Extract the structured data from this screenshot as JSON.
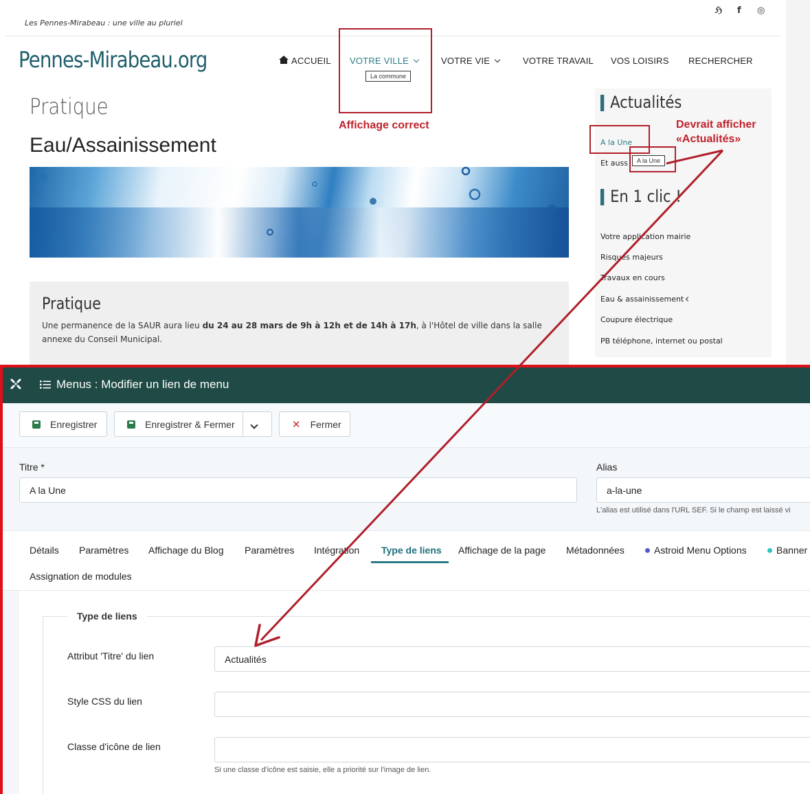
{
  "site": {
    "tagline": "Les Pennes-Mirabeau : une ville au pluriel",
    "social_icons": [
      "accessibility-icon",
      "facebook-icon",
      "instagram-icon"
    ],
    "logo": "Pennes-Mirabeau.org",
    "nav": {
      "accueil": "ACCUEIL",
      "votre_ville": "VOTRE VILLE",
      "votre_vie": "VOTRE VIE",
      "votre_travail": "VOTRE TRAVAIL",
      "vos_loisirs": "VOS LOISIRS",
      "rechercher": "RECHERCHER"
    },
    "nav_tooltip": "La commune",
    "page_title": "Pratique",
    "page_subtitle": "Eau/Assainissement",
    "box": {
      "title": "Pratique",
      "text_before": "Une permanence de la SAUR aura lieu ",
      "text_bold1": "du 24 au 28 mars de 9h à 12h et de 14h à 17h",
      "text_after": ", à l'Hôtel de ville dans la salle annexe du Conseil Municipal."
    },
    "sidebar": {
      "actualites_title": "Actualités",
      "links_actu": [
        "A la Une",
        "Et auss"
      ],
      "tooltip": "A la Une",
      "clic_title": "En 1 clic !",
      "links_clic": [
        "Votre application mairie",
        "Risques majeurs",
        "Travaux en cours",
        "Eau & assainissement",
        "Coupure électrique",
        "PB téléphone, internet ou postal"
      ]
    },
    "annotations": {
      "correct": "Affichage correct",
      "should_line1": "Devrait afficher",
      "should_line2": "«Actualités»"
    }
  },
  "admin": {
    "title": "Menus : Modifier un lien de menu",
    "toolbar": {
      "save": "Enregistrer",
      "save_close": "Enregistrer & Fermer",
      "close": "Fermer"
    },
    "titre_label": "Titre *",
    "titre_value": "A la Une",
    "alias_label": "Alias",
    "alias_value": "a-la-une",
    "alias_help": "L'alias est utilisé dans l'URL SEF. Si le champ est laissé vi",
    "tabs": [
      "Détails",
      "Paramètres",
      "Affichage du Blog",
      "Paramètres",
      "Intégration",
      "Type de liens",
      "Affichage de la page",
      "Métadonnées",
      "Astroid Menu Options",
      "Banner",
      "Assignation de modules"
    ],
    "fieldset_legend": "Type de liens",
    "fields": {
      "title_attr_label": "Attribut 'Titre' du lien",
      "title_attr_value": "Actualités",
      "css_label": "Style CSS du lien",
      "css_value": "",
      "icon_label": "Classe d'icône de lien",
      "icon_value": "",
      "icon_help": "Si une classe d'icône est saisie, elle a priorité sur l'image de lien."
    },
    "colors": {
      "header": "#1f4a45",
      "accent": "#2b7a87",
      "frame": "#e0101a"
    }
  }
}
